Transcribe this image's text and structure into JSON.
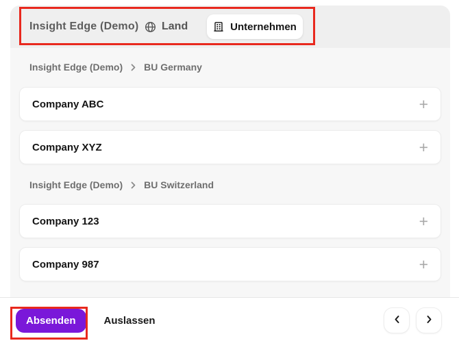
{
  "header": {
    "title": "Insight Edge (Demo)",
    "tabs": [
      {
        "label": "Land",
        "icon": "globe-icon",
        "active": false
      },
      {
        "label": "Unternehmen",
        "icon": "building-icon",
        "active": true
      }
    ]
  },
  "groups": [
    {
      "breadcrumb": {
        "root": "Insight Edge (Demo)",
        "section": "BU Germany"
      },
      "companies": [
        {
          "name": "Company ABC",
          "expand_icon": "plus-icon"
        },
        {
          "name": "Company XYZ",
          "expand_icon": "plus-icon"
        }
      ]
    },
    {
      "breadcrumb": {
        "root": "Insight Edge (Demo)",
        "section": "BU Switzerland"
      },
      "companies": [
        {
          "name": "Company 123",
          "expand_icon": "plus-icon"
        },
        {
          "name": "Company 987",
          "expand_icon": "plus-icon"
        }
      ]
    }
  ],
  "footer": {
    "submit_label": "Absenden",
    "skip_label": "Auslassen",
    "prev_icon": "chevron-left-icon",
    "next_icon": "chevron-right-icon"
  },
  "glyphs": {
    "plus": "+"
  },
  "colors": {
    "accent_purple": "#7a18d9",
    "annotation_red": "#e8281d",
    "header_bg": "#efefef",
    "body_bg": "#f7f7f7",
    "card_bg": "#ffffff",
    "muted_text": "#6e6e6e",
    "dark_text": "#141414"
  }
}
